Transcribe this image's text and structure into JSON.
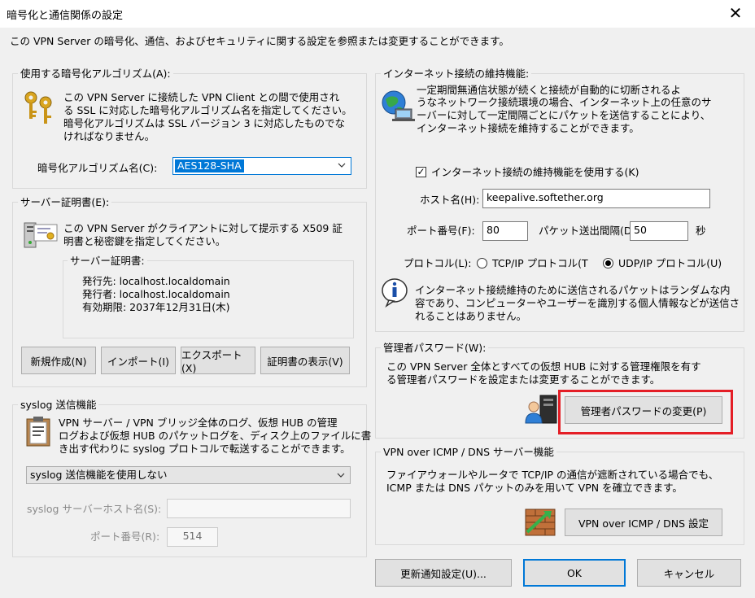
{
  "window": {
    "title": "暗号化と通信関係の設定",
    "close_icon": "✕"
  },
  "intro": "この VPN Server の暗号化、通信、およびセキュリティに関する設定を参照または変更することができます。",
  "cipher": {
    "legend": "使用する暗号化アルゴリズム(A):",
    "desc": [
      "この VPN Server に接続した VPN Client との間で使用され",
      "る SSL に対応した暗号化アルゴリズム名を指定してください。",
      "暗号化アルゴリズムは SSL バージョン 3 に対応したものでな",
      "ければなりません。"
    ],
    "label": "暗号化アルゴリズム名(C):",
    "value": "AES128-SHA"
  },
  "cert": {
    "legend": "サーバー証明書(E):",
    "desc": [
      "この VPN Server がクライアントに対して提示する X509 証",
      "明書と秘密鍵を指定してください。"
    ],
    "frame_title": "サーバー証明書:",
    "lines": [
      "発行先: localhost.localdomain",
      "発行者: localhost.localdomain",
      "有効期限: 2037年12月31日(木)"
    ],
    "btn_new": "新規作成(N)",
    "btn_import": "インポート(I)",
    "btn_export": "エクスポート(X)",
    "btn_view": "証明書の表示(V)"
  },
  "syslog": {
    "legend": "syslog 送信機能",
    "desc": [
      "VPN サーバー / VPN ブリッジ全体のログ、仮想 HUB の管理",
      "ログおよび仮想 HUB のパケットログを、ディスク上のファイルに書",
      "き出す代わりに syslog プロトコルで転送することができます。"
    ],
    "select_value": "syslog 送信機能を使用しない",
    "host_label": "syslog サーバーホスト名(S):",
    "host_value": "",
    "port_label": "ポート番号(R):",
    "port_value": "514"
  },
  "keepalive": {
    "legend": "インターネット接続の維持機能:",
    "desc": [
      "一定期間無通信状態が続くと接続が自動的に切断されるよ",
      "うなネットワーク接続環境の場合、インターネット上の任意のサ",
      "ーバーに対して一定間隔ごとにパケットを送信することにより、",
      "インターネット接続を維持することができます。"
    ],
    "checkbox_label": "インターネット接続の維持機能を使用する(K)",
    "checked_mark": "✓",
    "host_label": "ホスト名(H):",
    "host_value": "keepalive.softether.org",
    "port_label": "ポート番号(F):",
    "port_value": "80",
    "interval_label": "パケット送出間隔(D):",
    "interval_value": "50",
    "interval_unit": "秒",
    "protocol_label": "プロトコル(L):",
    "tcp_label": "TCP/IP プロトコル(T",
    "udp_label": "UDP/IP プロトコル(U)",
    "info": [
      "インターネット接続維持のために送信されるパケットはランダムな内",
      "容であり、コンピューターやユーザーを識別する個人情報などが送信さ",
      "れることはありません。"
    ]
  },
  "admin": {
    "legend": "管理者パスワード(W):",
    "desc": [
      "この VPN Server 全体とすべての仮想 HUB に対する管理権限を有す",
      "る管理者パスワードを設定または変更することができます。"
    ],
    "button": "管理者パスワードの変更(P)"
  },
  "icmp": {
    "legend": "VPN over ICMP / DNS サーバー機能",
    "desc": [
      "ファイアウォールやルータで TCP/IP の通信が遮断されている場合でも、",
      "ICMP または DNS パケットのみを用いて VPN を確立できます。"
    ],
    "button": "VPN over ICMP / DNS 設定"
  },
  "footer": {
    "update": "更新通知設定(U)...",
    "ok": "OK",
    "cancel": "キャンセル"
  }
}
